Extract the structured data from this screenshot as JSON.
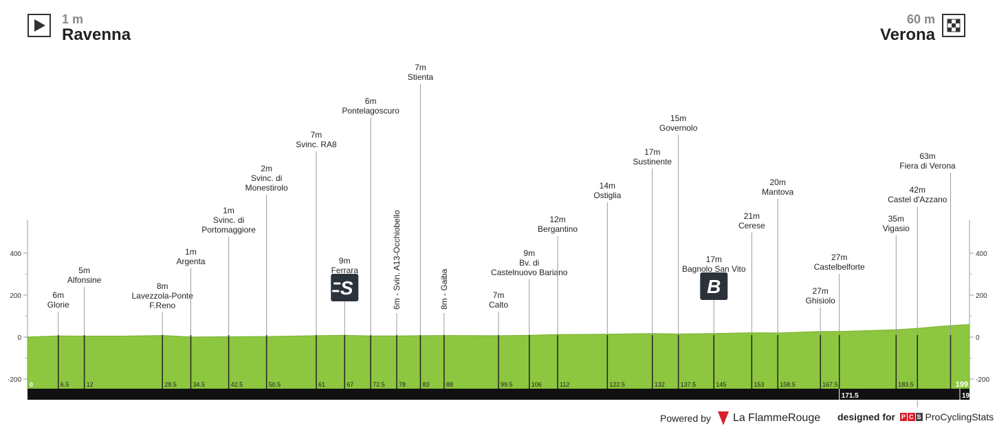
{
  "start": {
    "altitude": "1 m",
    "name": "Ravenna"
  },
  "finish": {
    "altitude": "60 m",
    "name": "Verona"
  },
  "footer": {
    "powered_by": "Powered by",
    "lfr_name": "La FlammeRouge",
    "designed_for": "designed for",
    "pcs_letters": [
      "P",
      "C",
      "S"
    ],
    "pcs_name": "ProCyclingStats"
  },
  "colors": {
    "profile": "#8dc63f",
    "bar": "#111111",
    "accent": "#d8202a"
  },
  "chart_data": {
    "type": "area",
    "xlabel": "",
    "ylabel": "",
    "ylim": [
      -200,
      400
    ],
    "yticks": [
      -200,
      0,
      200,
      400
    ],
    "xlim": [
      0,
      199
    ],
    "profile": [
      [
        0,
        1
      ],
      [
        6.5,
        6
      ],
      [
        12,
        5
      ],
      [
        20,
        5
      ],
      [
        28.5,
        8
      ],
      [
        34.5,
        1
      ],
      [
        42.5,
        2
      ],
      [
        50.5,
        3
      ],
      [
        61,
        7
      ],
      [
        67,
        9
      ],
      [
        72.5,
        6
      ],
      [
        78,
        6
      ],
      [
        83,
        7
      ],
      [
        88,
        8
      ],
      [
        99.5,
        7
      ],
      [
        106,
        9
      ],
      [
        112,
        12
      ],
      [
        122.5,
        14
      ],
      [
        132,
        17
      ],
      [
        137.5,
        15
      ],
      [
        145,
        17
      ],
      [
        153,
        21
      ],
      [
        158.5,
        20
      ],
      [
        167.5,
        27
      ],
      [
        171.5,
        27
      ],
      [
        183.5,
        35
      ],
      [
        188,
        42
      ],
      [
        192,
        50
      ],
      [
        195,
        55
      ],
      [
        199,
        60
      ]
    ],
    "km_ticks": [
      "0",
      "6.5",
      "12",
      "28.5",
      "34.5",
      "42.5",
      "50.5",
      "61",
      "67",
      "72.5",
      "78",
      "83",
      "88",
      "99.5",
      "106",
      "112",
      "122.5",
      "132",
      "137.5",
      "145",
      "153",
      "158.5",
      "167.5",
      "183.5",
      "199"
    ],
    "bar_ticks": [
      "171.5",
      "19"
    ],
    "waypoints": [
      {
        "km": 6.5,
        "alt": "6m",
        "name": [
          "Glorie"
        ]
      },
      {
        "km": 12,
        "alt": "5m",
        "name": [
          "Alfonsine"
        ]
      },
      {
        "km": 28.5,
        "alt": "8m",
        "name": [
          "Lavezzola-Ponte",
          "F.Reno"
        ]
      },
      {
        "km": 34.5,
        "alt": "1m",
        "name": [
          "Argenta"
        ]
      },
      {
        "km": 42.5,
        "alt": "1m",
        "name": [
          "Svinc. di",
          "Portomaggiore"
        ]
      },
      {
        "km": 50.5,
        "alt": "2m",
        "name": [
          "Svinc. di",
          "Monestirolo"
        ]
      },
      {
        "km": 61,
        "alt": "7m",
        "name": [
          "Svinc. RA8"
        ]
      },
      {
        "km": 67,
        "alt": "9m",
        "name": [
          "Ferrara"
        ],
        "badge": "S"
      },
      {
        "km": 72.5,
        "alt": "6m",
        "name": [
          "Pontelagoscuro"
        ]
      },
      {
        "km": 78,
        "vertical": "6m - Svin. A13-Occhiobello"
      },
      {
        "km": 83,
        "alt": "7m",
        "name": [
          "Stienta"
        ]
      },
      {
        "km": 88,
        "vertical": "8m - Gaiba"
      },
      {
        "km": 99.5,
        "alt": "7m",
        "name": [
          "Calto"
        ]
      },
      {
        "km": 106,
        "alt": "9m",
        "name": [
          "Bv. di",
          "Castelnuovo Bariano"
        ]
      },
      {
        "km": 112,
        "alt": "12m",
        "name": [
          "Bergantino"
        ]
      },
      {
        "km": 122.5,
        "alt": "14m",
        "name": [
          "Ostiglia"
        ]
      },
      {
        "km": 132,
        "alt": "17m",
        "name": [
          "Sustinente"
        ]
      },
      {
        "km": 137.5,
        "alt": "15m",
        "name": [
          "Governolo"
        ]
      },
      {
        "km": 145,
        "alt": "17m",
        "name": [
          "Bagnolo San Vito"
        ],
        "badge": "B"
      },
      {
        "km": 153,
        "alt": "21m",
        "name": [
          "Cerese"
        ]
      },
      {
        "km": 158.5,
        "alt": "20m",
        "name": [
          "Mantova"
        ]
      },
      {
        "km": 167.5,
        "alt": "27m",
        "name": [
          "Ghisiolo"
        ]
      },
      {
        "km": 171.5,
        "alt": "27m",
        "name": [
          "Castelbelforte"
        ]
      },
      {
        "km": 183.5,
        "alt": "35m",
        "name": [
          "Vigasio"
        ]
      },
      {
        "km": 188,
        "alt": "42m",
        "name": [
          "Castel d'Azzano"
        ]
      },
      {
        "km": 195,
        "alt": "63m",
        "name": [
          "Fiera di Verona"
        ]
      }
    ]
  }
}
